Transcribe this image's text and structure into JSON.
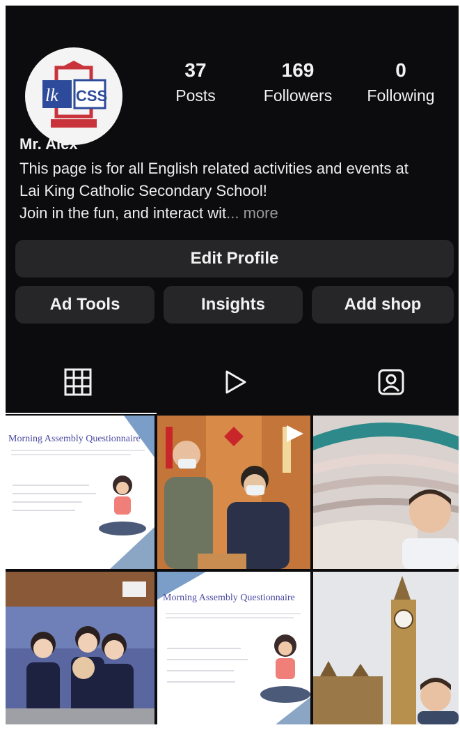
{
  "profile": {
    "name": "Mr. Alex",
    "bio_line1": "This page is for all English related activities and events at",
    "bio_line2": "Lai King Catholic Secondary School!",
    "bio_line3": "Join in the fun, and interact wit",
    "bio_more": "... more",
    "avatar_logo_text": "LKCSS"
  },
  "stats": {
    "posts": {
      "value": "37",
      "label": "Posts"
    },
    "followers": {
      "value": "169",
      "label": "Followers"
    },
    "following": {
      "value": "0",
      "label": "Following"
    }
  },
  "buttons": {
    "edit_profile": "Edit Profile",
    "ad_tools": "Ad Tools",
    "insights": "Insights",
    "add_shop": "Add shop"
  },
  "tabs": [
    {
      "icon": "grid-icon",
      "active": true
    },
    {
      "icon": "reels-play-icon",
      "active": false
    },
    {
      "icon": "tagged-person-icon",
      "active": false
    }
  ],
  "posts": [
    {
      "kind": "questionnaire",
      "title": "Morning Assembly Questionnaire"
    },
    {
      "kind": "photo",
      "subject": "two teachers talking"
    },
    {
      "kind": "photo",
      "subject": "selfie in theatre"
    },
    {
      "kind": "photo",
      "subject": "students in hall"
    },
    {
      "kind": "questionnaire",
      "title": "Morning Assembly Questionnaire"
    },
    {
      "kind": "photo",
      "subject": "selfie at Big Ben"
    }
  ],
  "colors": {
    "background": "#0c0c0e",
    "button": "#262628",
    "text": "#f2f2f2"
  }
}
